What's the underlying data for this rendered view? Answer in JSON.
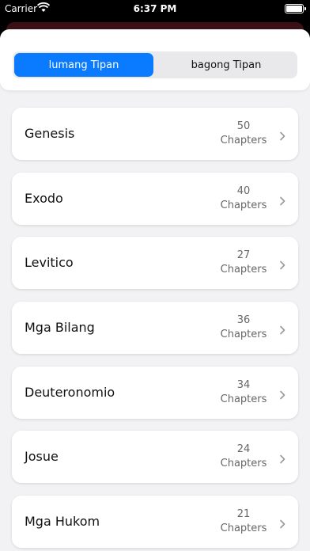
{
  "status": {
    "carrier": "Carrier",
    "time": "6:37 PM"
  },
  "segments": [
    {
      "label": "lumang Tipan",
      "active": true
    },
    {
      "label": "bagong Tipan",
      "active": false
    }
  ],
  "books": [
    {
      "name": "Genesis",
      "count": "50",
      "unit": "Chapters"
    },
    {
      "name": "Exodo",
      "count": "40",
      "unit": "Chapters"
    },
    {
      "name": "Levitico",
      "count": "27",
      "unit": "Chapters"
    },
    {
      "name": "Mga Bilang",
      "count": "36",
      "unit": "Chapters"
    },
    {
      "name": "Deuteronomio",
      "count": "34",
      "unit": "Chapters"
    },
    {
      "name": "Josue",
      "count": "24",
      "unit": "Chapters"
    },
    {
      "name": "Mga Hukom",
      "count": "21",
      "unit": "Chapters"
    }
  ],
  "colors": {
    "accent": "#0a7bff",
    "background": "#f2f2f4"
  }
}
